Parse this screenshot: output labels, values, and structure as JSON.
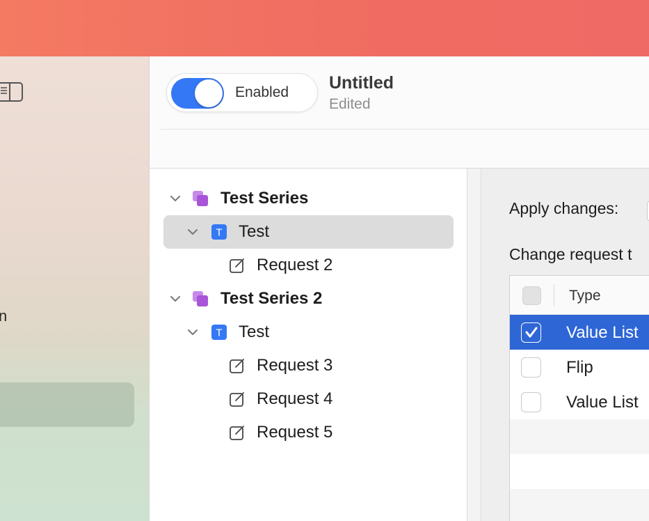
{
  "header": {
    "toggle_label": "Enabled",
    "toggle_on": true,
    "doc_title": "Untitled",
    "doc_subtitle": "Edited"
  },
  "sidebar": {
    "clipped_text": "n"
  },
  "tree": {
    "items": [
      {
        "label": "Test Series",
        "kind": "series",
        "expanded": true
      },
      {
        "label": "Test",
        "kind": "test",
        "expanded": true,
        "selected": true
      },
      {
        "label": "Request 2",
        "kind": "request"
      },
      {
        "label": "Test Series 2",
        "kind": "series",
        "expanded": true
      },
      {
        "label": "Test",
        "kind": "test",
        "expanded": true
      },
      {
        "label": "Request 3",
        "kind": "request"
      },
      {
        "label": "Request 4",
        "kind": "request"
      },
      {
        "label": "Request 5",
        "kind": "request"
      }
    ]
  },
  "panel": {
    "apply_label": "Apply changes:",
    "change_label": "Change request t",
    "table": {
      "column_type": "Type",
      "rows": [
        {
          "type": "Value List",
          "checked": true,
          "selected": true
        },
        {
          "type": "Flip",
          "checked": false
        },
        {
          "type": "Value List",
          "checked": false
        }
      ]
    }
  },
  "colors": {
    "accent": "#3478f6",
    "selection_blue": "#2e66d6",
    "series_icon": "#a855d8",
    "test_icon": "#3478f6"
  },
  "icons": {
    "series": "stacked-squares-icon",
    "test": "letter-t-icon",
    "request": "edit-square-icon",
    "chevron": "chevron-down-icon",
    "sidebar_toggle": "sidebar-toggle-icon"
  }
}
